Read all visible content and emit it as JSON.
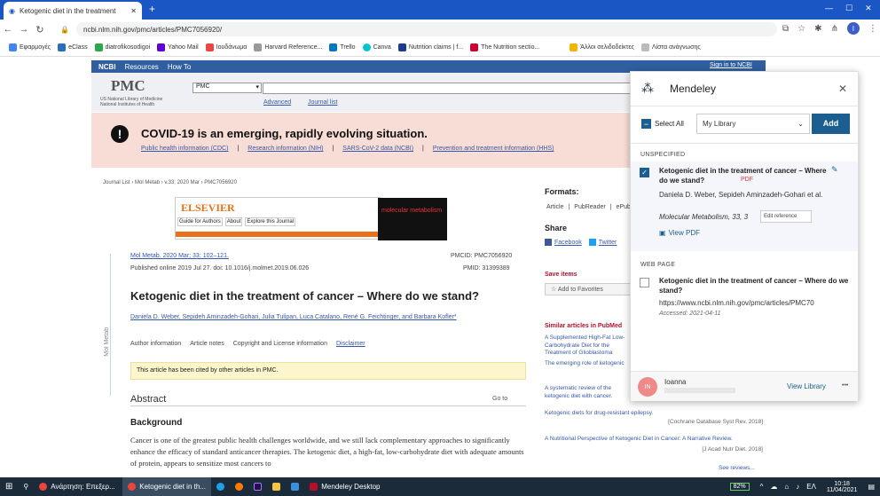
{
  "browser": {
    "tabs": [
      {
        "title": "Ketogenic diet in the treatment",
        "active": true
      }
    ],
    "new_tab": "+",
    "url": "ncbi.nlm.nih.gov/pmc/articles/PMC7056920/",
    "profile": "I",
    "bookmarks": [
      "Εφαρμογές",
      "eClass",
      "diatrofikosodigoi",
      "Yahoo Mail",
      "Ιουδάνωμα",
      "Harvard Reference...",
      "Trello",
      "Canva",
      "Nutrition claims | f...",
      "The Nutrition sectio...",
      "Άλλοι σελιδοδείκτες",
      "Λίστα ανάγνωσης"
    ]
  },
  "ncbi": {
    "nav": [
      "NCBI",
      "Resources",
      "How To"
    ],
    "signin": "Sign in to NCBI",
    "pmc": "PMC",
    "pmc_sub": "US National Library of Medicine\nNational Institutes of Health",
    "search_db": "PMC",
    "advanced": "Advanced",
    "journal_list": "Journal list"
  },
  "covid": {
    "title": "COVID-19 is an emerging, rapidly evolving situation.",
    "links": [
      "Public health information (CDC)",
      "Research information (NIH)",
      "SARS-CoV-2 data (NCBI)",
      "Prevention and treatment information (HHS)"
    ]
  },
  "article": {
    "breadcrumb": "Journal List › Mol Metab › v.33; 2020 Mar › PMC7056920",
    "elsevier": "ELSEVIER",
    "elsevier_links": [
      "Guide for Authors",
      "About",
      "Explore this Journal"
    ],
    "journal_banner": "molecular metabolism",
    "side_label": "Mol Metab",
    "citation": "Mol Metab. 2020 Mar; 33: 102–121.",
    "published": "Published online 2019 Jul 27. doi: 10.1016/j.molmet.2019.06.026",
    "pmcid": "PMCID: PMC7056920",
    "pmid": "PMID: 31399389",
    "title": "Ketogenic diet in the treatment of cancer – Where do we stand?",
    "authors": "Daniela D. Weber, Sepideh Aminzadeh-Gohari, Julia Tulipan, Luca Catalano, René G. Feichtinger, and Barbara Kofler*",
    "meta_links": [
      "Author information",
      "Article notes",
      "Copyright and License information",
      "Disclaimer"
    ],
    "cited": "This article has been cited by other articles in PMC.",
    "abstract": "Abstract",
    "goto": "Go to",
    "background": "Background",
    "body": "Cancer is one of the greatest public health challenges worldwide, and we still lack complementary approaches to significantly enhance the efficacy of standard anticancer therapies. The ketogenic diet, a high-fat, low-carbohydrate diet with adequate amounts of protein, appears to sensitize most cancers to"
  },
  "right": {
    "formats": "Formats:",
    "format_links": [
      "Article",
      "PubReader",
      "ePub"
    ],
    "share": "Share",
    "share_links": [
      "Facebook",
      "Twitter"
    ],
    "save": "Save items",
    "add_fav": "Add to Favorites",
    "similar": "Similar articles in PubMed",
    "similar_items": [
      "A Supplemented High-Fat Low-Carbohydrate Diet for the Treatment of Glioblastoma",
      "The emerging role of ketogenic",
      "A systematic review of the ketogenic diet with cancer.",
      "Ketogenic diets for drug-resistant epilepsy.",
      "[Cochrane Database Syst Rev. 2018]",
      "A Nutritional Perspective of Ketogenic Diet in Cancer: A Narrative Review.",
      "[J Acad Nutr Diet. 2018]"
    ],
    "see_reviews": "See reviews..."
  },
  "mendeley": {
    "brand": "Mendeley",
    "select_all": "Select All",
    "library": "My Library",
    "add": "Add",
    "unspecified": "UNSPECIFIED",
    "item1_title": "Ketogenic diet in the treatment of cancer – Where do we stand?",
    "pdf": "PDF",
    "item1_authors": "Daniela D. Weber, Sepideh Aminzadeh-Gohari et al.",
    "item1_journal": "Molecular Metabolism, 33, 3",
    "edit_ref": "Edit reference",
    "view_pdf": "View PDF",
    "webpage": "WEB PAGE",
    "item2_title": "Ketogenic diet in the treatment of cancer – Where do we stand?",
    "item2_url": "https://www.ncbi.nlm.nih.gov/pmc/articles/PMC70",
    "accessed": "Accessed: 2021-04-11",
    "user_initials": "IN",
    "user_name": "Ioanna",
    "view_library": "View Library",
    "more": "•••"
  },
  "taskbar": {
    "search_app": "Ανάρτηση: Επεξερ...",
    "chrome_title": "Ketogenic diet in th...",
    "mendeley_app": "Mendeley Desktop",
    "battery": "82%",
    "lang": "ΕΛ",
    "time": "10:18",
    "date": "11/04/2021"
  }
}
